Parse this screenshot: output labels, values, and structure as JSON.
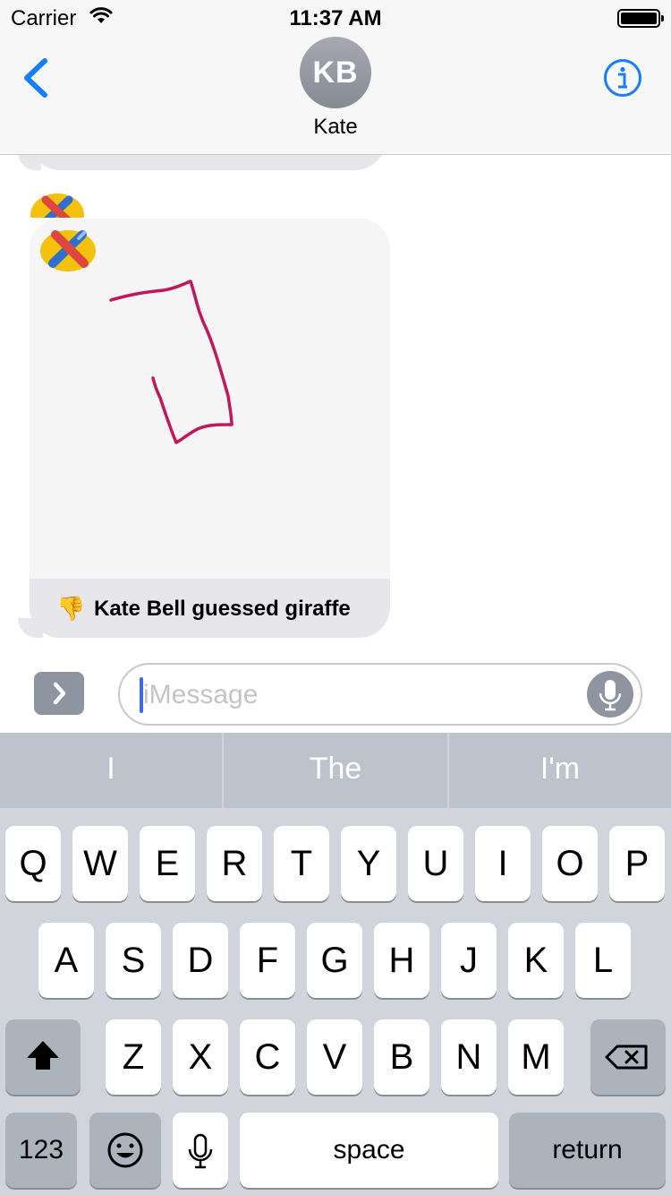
{
  "status_bar": {
    "carrier": "Carrier",
    "time": "11:37 AM"
  },
  "nav": {
    "avatar_initials": "KB",
    "contact_name": "Kate"
  },
  "message": {
    "caption": "Kate Bell guessed giraffe",
    "thumb_emoji": "👎",
    "stroke_color": "#c2185b"
  },
  "input": {
    "placeholder": "iMessage"
  },
  "suggestions": [
    "I",
    "The",
    "I'm"
  ],
  "keyboard": {
    "row1": [
      "Q",
      "W",
      "E",
      "R",
      "T",
      "Y",
      "U",
      "I",
      "O",
      "P"
    ],
    "row2": [
      "A",
      "S",
      "D",
      "F",
      "G",
      "H",
      "J",
      "K",
      "L"
    ],
    "row3": [
      "Z",
      "X",
      "C",
      "V",
      "B",
      "N",
      "M"
    ],
    "numbers_label": "123",
    "space_label": "space",
    "return_label": "return"
  },
  "colors": {
    "accent": "#147efb",
    "bubble": "#e6e6eb",
    "keyboard_bg": "#d1d5db",
    "cursor": "#3f6ce6"
  }
}
